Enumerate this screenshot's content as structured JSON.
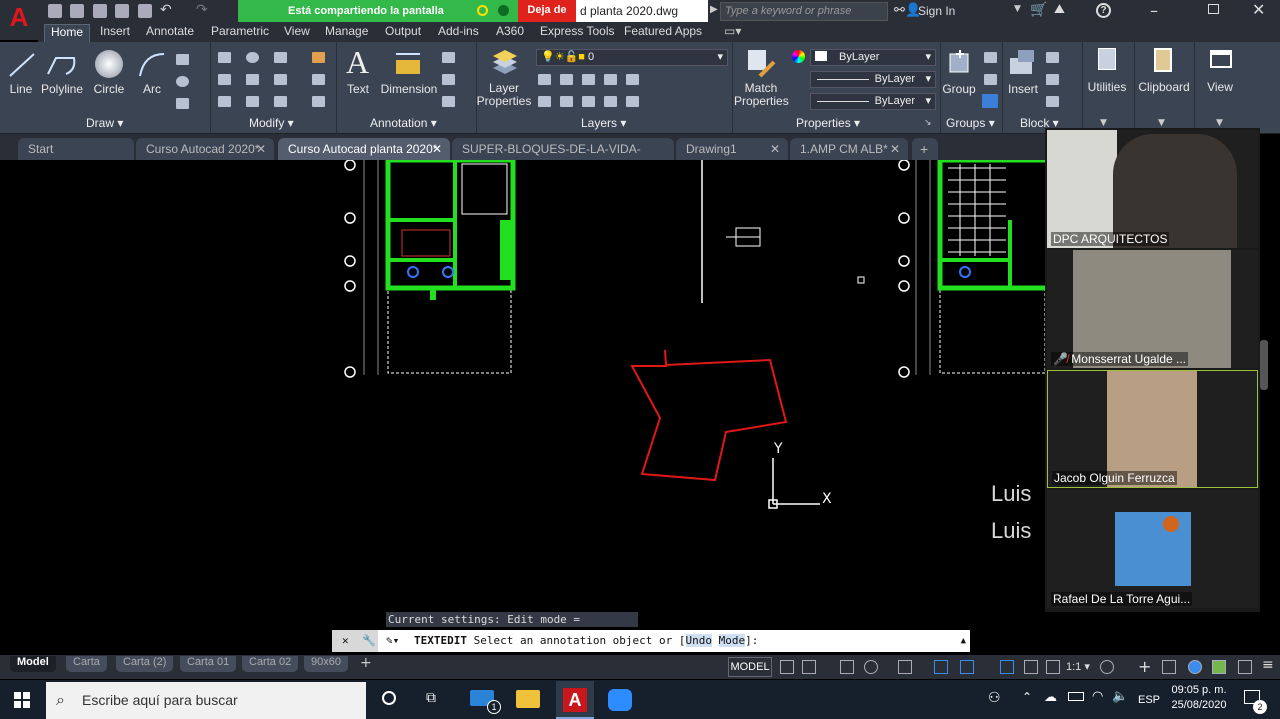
{
  "titlebar": {
    "app_logo": "A",
    "share_status": "Está compartiendo la pantalla",
    "stop_share": "Deja de",
    "doc_title": "d planta 2020.dwg",
    "search_placeholder": "Type a keyword or phrase",
    "sign_in": "Sign In"
  },
  "ribbon_tabs": [
    "Home",
    "Insert",
    "Annotate",
    "Parametric",
    "View",
    "Manage",
    "Output",
    "Add-ins",
    "A360",
    "Express Tools",
    "Featured Apps"
  ],
  "ribbon": {
    "draw": {
      "line": "Line",
      "polyline": "Polyline",
      "circle": "Circle",
      "arc": "Arc",
      "title": "Draw"
    },
    "modify": {
      "title": "Modify"
    },
    "annotation": {
      "text": "Text",
      "dimension": "Dimension",
      "title": "Annotation"
    },
    "layers": {
      "layer_props_1": "Layer",
      "layer_props_2": "Properties",
      "current_layer": "0",
      "title": "Layers"
    },
    "properties": {
      "match_1": "Match",
      "match_2": "Properties",
      "color": "ByLayer",
      "linetype": "ByLayer",
      "lineweight": "ByLayer",
      "title": "Properties"
    },
    "groups": {
      "group": "Group",
      "title": "Groups"
    },
    "block": {
      "insert": "Insert",
      "title": "Block"
    },
    "utilities": "Utilities",
    "clipboard": "Clipboard",
    "view": "View"
  },
  "doc_tabs": [
    "Start",
    "Curso Autocad 2020*",
    "Curso Autocad planta 2020*",
    "SUPER-BLOQUES-DE-LA-VIDA-copia*",
    "Drawing1",
    "1.AMP CM ALB*"
  ],
  "drawing": {
    "ucs_y": "Y",
    "ucs_x": "X",
    "luis_1": "Luis",
    "luis_2": "Luis",
    "colors": {
      "walls": "#22e01f",
      "shape": "#e01818",
      "lines": "#ffffff"
    }
  },
  "command": {
    "history": "Current settings: Edit mode = Multiple",
    "prompt_name": "TEXTEDIT",
    "prompt_text": "Select an annotation object or [",
    "opt_undo": "Undo",
    "opt_mode": "Mode",
    "prompt_end": "]:"
  },
  "layout_tabs": [
    "Model",
    "Carta",
    "Carta (2)",
    "Carta 01",
    "Carta 02",
    "90x60"
  ],
  "status": {
    "model": "MODEL",
    "scale": "1:1"
  },
  "participants": [
    {
      "name": "DPC ARQUITECTOS",
      "muted": false
    },
    {
      "name": "Monsserrat Ugalde ...",
      "muted": true
    },
    {
      "name": "Jacob Olguin Ferruzca",
      "muted": false
    },
    {
      "name": "Rafael De La Torre Agui...",
      "muted": false
    }
  ],
  "taskbar": {
    "search_placeholder": "Escribe aquí para buscar",
    "mail_badge": "1",
    "lang": "ESP",
    "time": "09:05 p. m.",
    "date": "25/08/2020",
    "notifications": "2"
  }
}
